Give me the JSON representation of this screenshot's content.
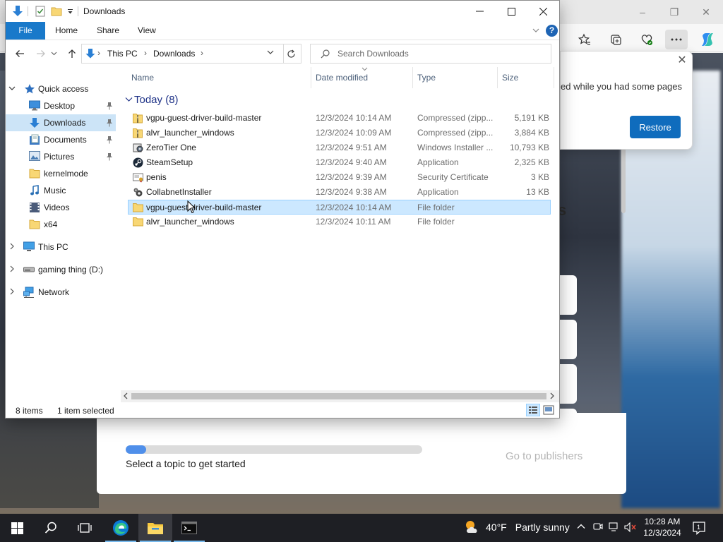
{
  "background": {
    "restore_popup": {
      "message": "ed while you had some pages",
      "button": "Restore"
    },
    "newtab": {
      "progress_fraction": 0.07,
      "topic_label": "Select a topic to get started",
      "publishers_link": "Go to publishers"
    },
    "partial_letter": "s"
  },
  "explorer": {
    "title": "Downloads",
    "ribbon_tabs": [
      "File",
      "Home",
      "Share",
      "View"
    ],
    "address": [
      "This PC",
      "Downloads"
    ],
    "search_placeholder": "Search Downloads",
    "sidebar": [
      {
        "label": "Quick access",
        "icon": "star-icon"
      },
      {
        "label": "Desktop",
        "icon": "desktop-icon",
        "pinned": true
      },
      {
        "label": "Downloads",
        "icon": "download-arrow-icon",
        "pinned": true,
        "selected": true
      },
      {
        "label": "Documents",
        "icon": "documents-icon",
        "pinned": true
      },
      {
        "label": "Pictures",
        "icon": "pictures-icon",
        "pinned": true
      },
      {
        "label": "kernelmode",
        "icon": "folder-icon"
      },
      {
        "label": "Music",
        "icon": "music-icon"
      },
      {
        "label": "Videos",
        "icon": "videos-icon"
      },
      {
        "label": "x64",
        "icon": "folder-icon"
      },
      {
        "label": "This PC",
        "icon": "computer-icon"
      },
      {
        "label": "gaming thing (D:)",
        "icon": "drive-icon"
      },
      {
        "label": "Network",
        "icon": "network-icon"
      }
    ],
    "columns": {
      "name": "Name",
      "date": "Date modified",
      "type": "Type",
      "size": "Size"
    },
    "group_label": "Today (8)",
    "files": [
      {
        "name": "vgpu-guest-driver-build-master",
        "date": "12/3/2024 10:14 AM",
        "type": "Compressed (zipp...",
        "size": "5,191 KB",
        "icon": "zip-folder-icon"
      },
      {
        "name": "alvr_launcher_windows",
        "date": "12/3/2024 10:09 AM",
        "type": "Compressed (zipp...",
        "size": "3,884 KB",
        "icon": "zip-folder-icon"
      },
      {
        "name": "ZeroTier One",
        "date": "12/3/2024 9:51 AM",
        "type": "Windows Installer ...",
        "size": "10,793 KB",
        "icon": "installer-icon"
      },
      {
        "name": "SteamSetup",
        "date": "12/3/2024 9:40 AM",
        "type": "Application",
        "size": "2,325 KB",
        "icon": "steam-icon"
      },
      {
        "name": "penis",
        "date": "12/3/2024 9:39 AM",
        "type": "Security Certificate",
        "size": "3 KB",
        "icon": "certificate-icon"
      },
      {
        "name": "CollabnetInstaller",
        "date": "12/3/2024 9:38 AM",
        "type": "Application",
        "size": "13 KB",
        "icon": "app-icon"
      },
      {
        "name": "vgpu-guest-driver-build-master",
        "date": "12/3/2024 10:14 AM",
        "type": "File folder",
        "size": "",
        "icon": "folder-icon",
        "selected": true
      },
      {
        "name": "alvr_launcher_windows",
        "date": "12/3/2024 10:11 AM",
        "type": "File folder",
        "size": "",
        "icon": "folder-icon"
      }
    ],
    "status": {
      "items": "8 items",
      "selected": "1 item selected"
    }
  },
  "taskbar": {
    "weather": {
      "temp": "40°F",
      "desc": "Partly sunny"
    },
    "clock": {
      "time": "10:28 AM",
      "date": "12/3/2024"
    },
    "notification_count": "1"
  }
}
